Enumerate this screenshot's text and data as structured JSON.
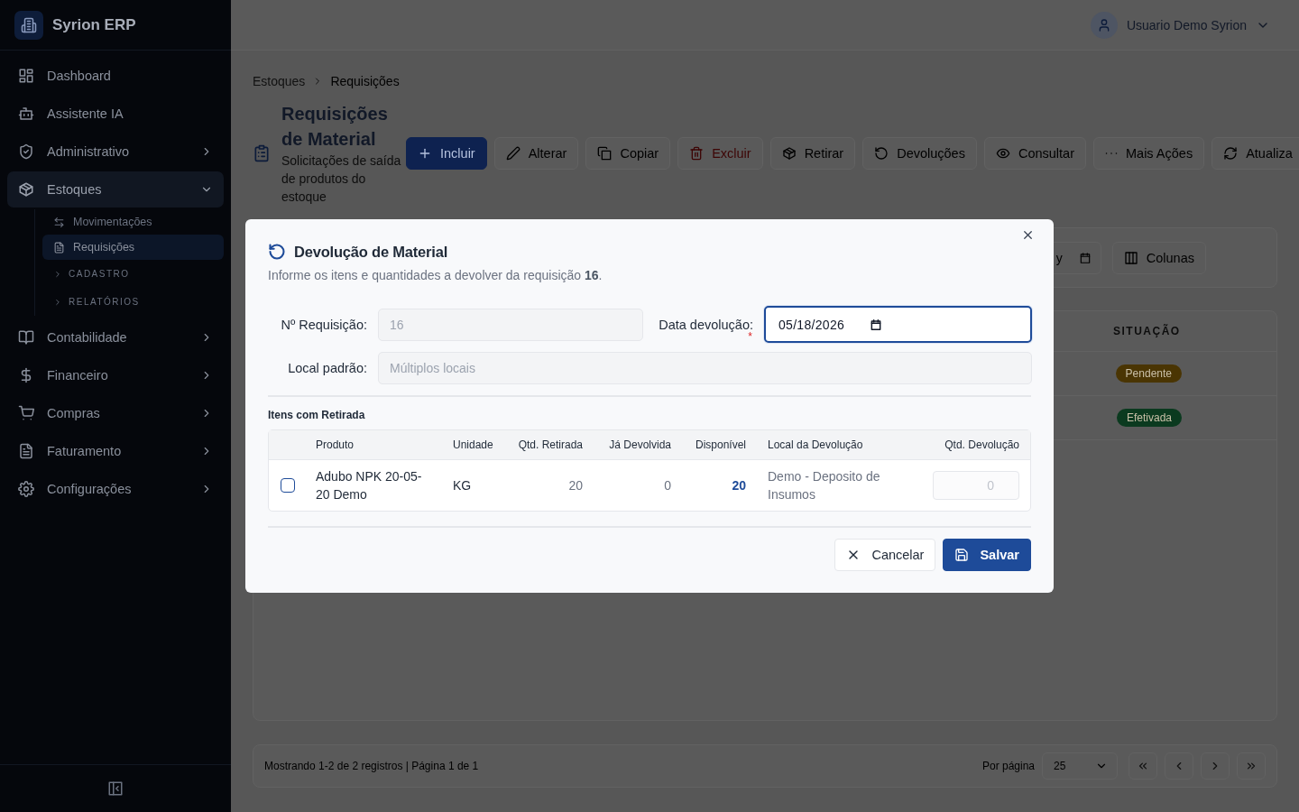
{
  "app": {
    "name": "Syrion ERP"
  },
  "sidebar": {
    "items": [
      {
        "label": "Dashboard",
        "selected": false
      },
      {
        "label": "Assistente IA",
        "selected": false
      },
      {
        "label": "Administrativo",
        "selected": false,
        "expanded": false
      },
      {
        "label": "Estoques",
        "selected": true,
        "expanded": true,
        "children": [
          {
            "kind": "link",
            "label": "Movimentações",
            "selected": false
          },
          {
            "kind": "link",
            "label": "Requisições",
            "selected": true
          },
          {
            "kind": "section",
            "label": "CADASTRO",
            "expanded": false
          },
          {
            "kind": "section",
            "label": "RELATÓRIOS",
            "expanded": false
          }
        ]
      },
      {
        "label": "Contabilidade",
        "selected": false,
        "expanded": false
      },
      {
        "label": "Financeiro",
        "selected": false,
        "expanded": false
      },
      {
        "label": "Compras",
        "selected": false,
        "expanded": false
      },
      {
        "label": "Faturamento",
        "selected": false,
        "expanded": false
      },
      {
        "label": "Configurações",
        "selected": false,
        "expanded": false
      }
    ]
  },
  "header": {
    "user": "Usuario Demo Syrion"
  },
  "breadcrumb": [
    "Estoques",
    "Requisições"
  ],
  "page": {
    "title": "Requisições de Material",
    "subtitle": "Solicitações de saída de produtos do estoque"
  },
  "toolbar": [
    {
      "kind": "primary",
      "label": "Incluir"
    },
    {
      "kind": "default",
      "label": "Alterar"
    },
    {
      "kind": "default",
      "label": "Copiar"
    },
    {
      "kind": "danger",
      "label": "Excluir"
    },
    {
      "kind": "default",
      "label": "Retirar"
    },
    {
      "kind": "default",
      "label": "Devoluções"
    },
    {
      "kind": "default",
      "label": "Consultar"
    },
    {
      "kind": "default",
      "label": "Mais Ações"
    },
    {
      "kind": "default",
      "label": "Atualiza"
    }
  ],
  "filters": {
    "date_fragment": "y",
    "columns_button": "Colunas"
  },
  "table": {
    "columns": [
      "SITUAÇÃO"
    ],
    "rows": [
      {
        "status": "Pendente",
        "color": "#4a3503"
      },
      {
        "status": "Efetivada",
        "color": "#0b3a1f"
      }
    ]
  },
  "pagination": {
    "summary": "Mostrando 1-2 de 2 registros | Página 1 de 1",
    "per_page_label": "Por página",
    "per_page": "25"
  },
  "dialog": {
    "title": "Devolução de Material",
    "description": "Informe os itens e quantidades a devolver da requisição **16**.",
    "fields": [
      {
        "label": "Nº Requisição:",
        "value": "16",
        "disabled": true
      },
      {
        "label": "Data devolução:",
        "required_mark": "*",
        "value": "05/18/2026",
        "disabled": false,
        "focused": true
      },
      {
        "label": "Local padrão:",
        "value": "Múltiplos locais",
        "disabled": true
      }
    ],
    "section_title": "Itens com Retirada",
    "columns": [
      "Produto",
      "Unidade",
      "Qtd. Retirada",
      "Já Devolvida",
      "Disponível",
      "Local da Devolução",
      "Qtd. Devolução"
    ],
    "rows": [
      {
        "checked": false,
        "product": "Adubo NPK 20-05-20 Demo",
        "unit": "KG",
        "withdrawn": "20",
        "returned": "0",
        "available": "20",
        "location": "Demo - Deposito de Insumos",
        "qty": "0",
        "qty_disabled": true
      }
    ],
    "buttons": [
      {
        "kind": "secondary",
        "label": "Cancelar"
      },
      {
        "kind": "primary",
        "label": "Salvar"
      }
    ]
  }
}
